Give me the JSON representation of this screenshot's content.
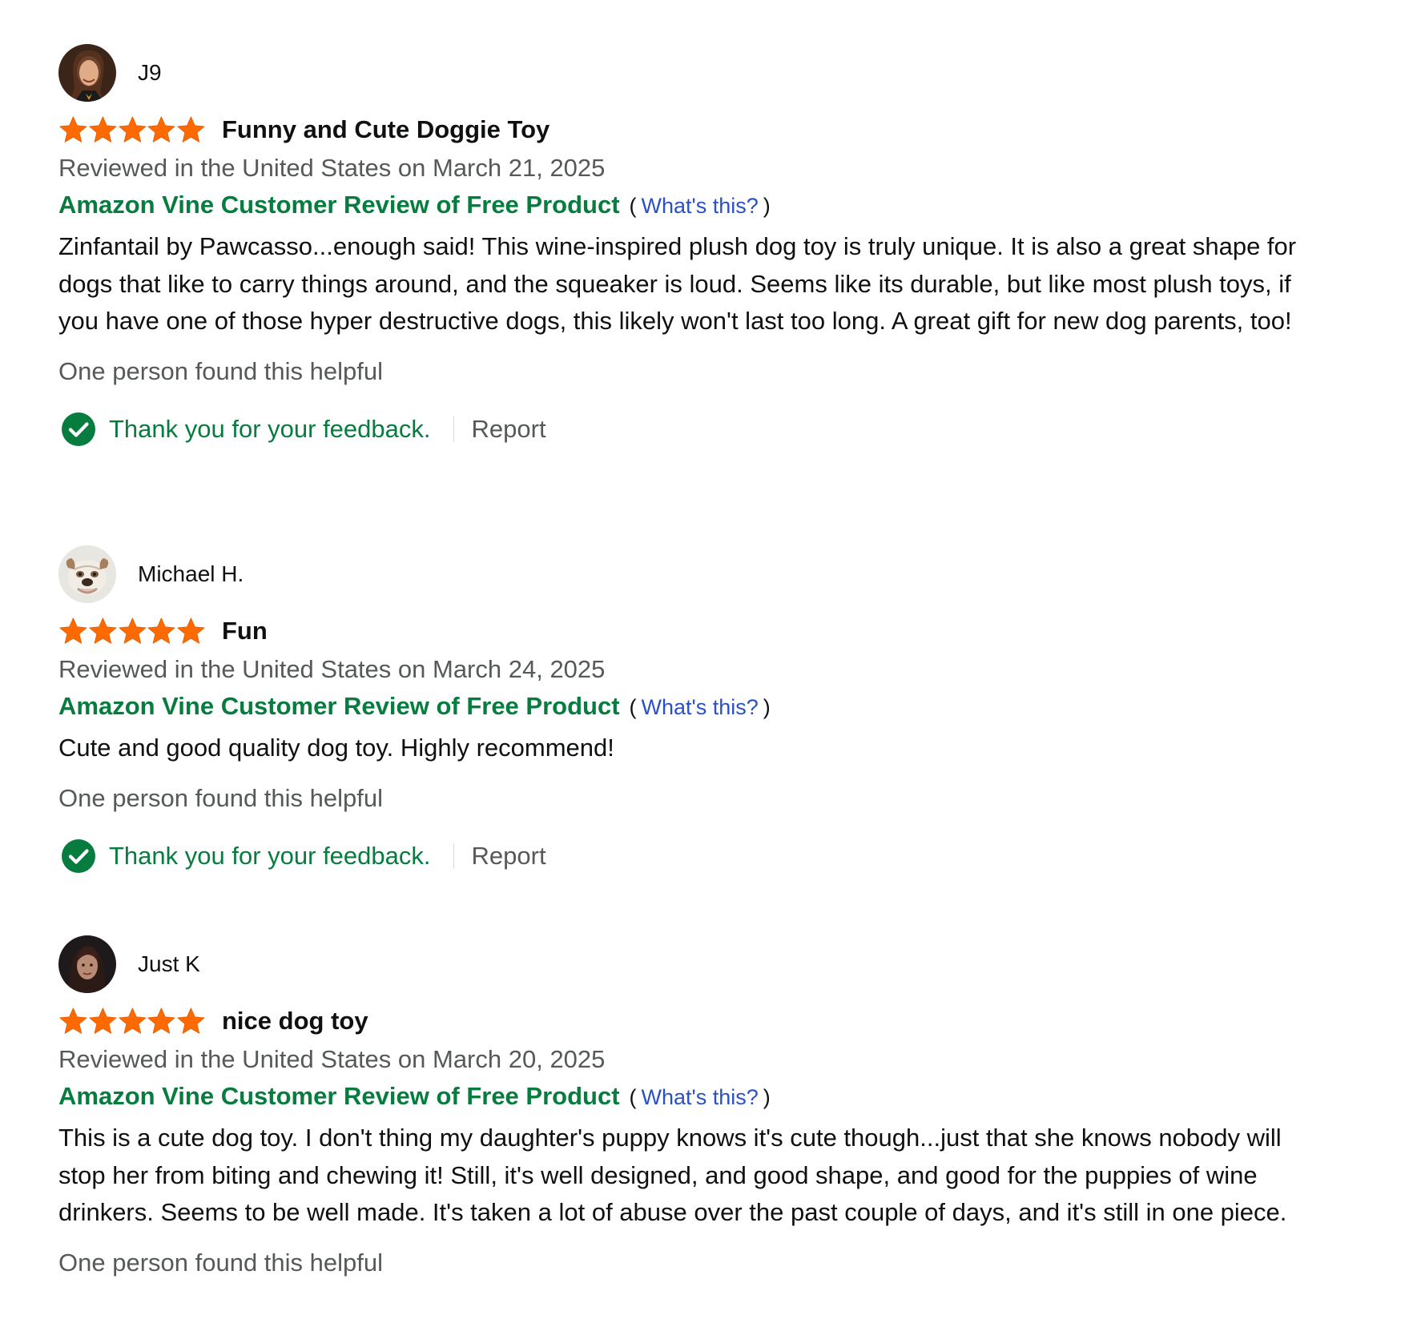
{
  "colors": {
    "star": "#ff6a00",
    "vine_green": "#067d3e",
    "link_blue": "#2a50c5",
    "muted_text": "#565959"
  },
  "reviews": [
    {
      "reviewer_name": "J9",
      "rating": 5,
      "title": "Funny and Cute Doggie Toy",
      "date_line": "Reviewed in the United States on March 21, 2025",
      "vine_label": "Amazon Vine Customer Review of Free Product",
      "paren_open": "(",
      "whats_this": "What's this?",
      "paren_close": ")",
      "body": "Zinfantail by Pawcasso...enough said! This wine-inspired plush dog toy is truly unique. It is also a great shape for dogs that like to carry things around, and the squeaker is loud. Seems like its durable, but like most plush toys, if you have one of those hyper destructive dogs, this likely won't last too long. A great gift for new dog parents, too!",
      "helpful_text": "One person found this helpful",
      "feedback_text": "Thank you for your feedback.",
      "report_label": "Report"
    },
    {
      "reviewer_name": "Michael H.",
      "rating": 5,
      "title": "Fun",
      "date_line": "Reviewed in the United States on March 24, 2025",
      "vine_label": "Amazon Vine Customer Review of Free Product",
      "paren_open": "(",
      "whats_this": "What's this?",
      "paren_close": ")",
      "body": "Cute and good quality dog toy. Highly recommend!",
      "helpful_text": "One person found this helpful",
      "feedback_text": "Thank you for your feedback.",
      "report_label": "Report"
    },
    {
      "reviewer_name": "Just K",
      "rating": 5,
      "title": "nice dog toy",
      "date_line": "Reviewed in the United States on March 20, 2025",
      "vine_label": "Amazon Vine Customer Review of Free Product",
      "paren_open": "(",
      "whats_this": "What's this?",
      "paren_close": ")",
      "body": "This is a cute dog toy. I don't thing my daughter's puppy knows it's cute though...just that she knows nobody will stop her from biting and chewing it! Still, it's well designed, and good shape, and good for the puppies of wine drinkers. Seems to be well made. It's taken a lot of abuse over the past couple of days, and it's still in one piece.",
      "helpful_text": "One person found this helpful"
    }
  ]
}
